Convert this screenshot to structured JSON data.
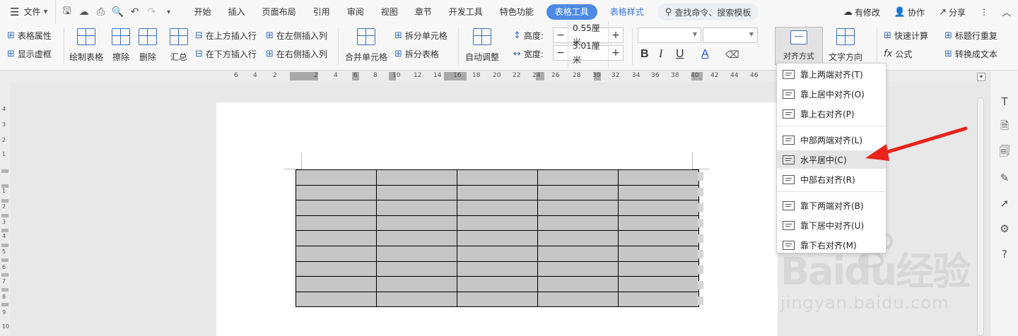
{
  "menu": {
    "file_label": "文件",
    "tabs": [
      "开始",
      "插入",
      "页面布局",
      "引用",
      "审阅",
      "视图",
      "章节",
      "开发工具",
      "特色功能"
    ],
    "active_tab": "表格工具",
    "context_tab": "表格样式",
    "search_placeholder": "查找命令、搜索模板",
    "modified": "有修改",
    "collaborate": "协作",
    "share": "分享"
  },
  "ribbon": {
    "table_props": "表格属性",
    "show_grid": "显示虚框",
    "draw_table": "绘制表格",
    "erase": "擦除",
    "delete": "删除",
    "summary": "汇总",
    "insert_above": "在上方插入行",
    "insert_below": "在下方插入行",
    "insert_left": "在左侧插入列",
    "insert_right": "在右侧插入列",
    "merge_cells": "合并单元格",
    "split_cells": "拆分单元格",
    "split_table": "拆分表格",
    "auto_fit": "自动调整",
    "height_label": "高度:",
    "height_value": "0.55厘米",
    "width_label": "宽度:",
    "width_value": "3.01厘米",
    "align": "对齐方式",
    "text_direction": "文字方向",
    "quick_calc": "快速计算",
    "repeat_header": "标题行重复",
    "formula": "公式",
    "convert_text": "转换成文本",
    "bold": "B",
    "italic": "I",
    "underline": "U",
    "font_color": "A"
  },
  "ruler_ticks": [
    "6",
    "4",
    "2",
    "2",
    "4",
    "6",
    "8",
    "10",
    "12",
    "14",
    "16",
    "18",
    "20",
    "22",
    "24",
    "26",
    "28",
    "30",
    "32",
    "34",
    "36",
    "38",
    "40",
    "42",
    "44",
    "46"
  ],
  "vruler_ticks": [
    "4",
    "3",
    "2",
    "1",
    "1",
    "2",
    "3",
    "4",
    "5",
    "6",
    "7",
    "8",
    "9",
    "10"
  ],
  "dropdown": {
    "items": [
      "靠上两端对齐(T)",
      "靠上居中对齐(O)",
      "靠上右对齐(P)",
      "中部两端对齐(L)",
      "水平居中(C)",
      "中部右对齐(R)",
      "靠下两端对齐(B)",
      "靠下居中对齐(U)",
      "靠下右对齐(M)"
    ],
    "selected": "水平居中(C)"
  },
  "watermark": {
    "brand": "Baidu经验",
    "url": "jingyan.baidu.com"
  },
  "colors": {
    "accent": "#4d8ae6",
    "arrow": "#e8231c",
    "table_fill": "#c6c6c6"
  }
}
